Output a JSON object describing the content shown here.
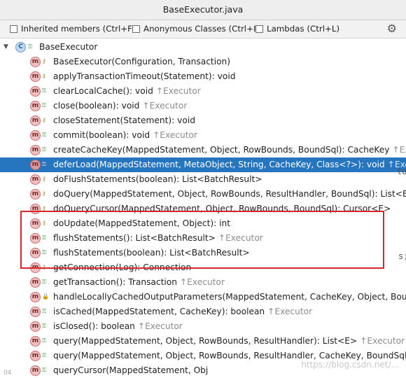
{
  "window": {
    "title": "BaseExecutor.java"
  },
  "options": {
    "inherited": "Inherited members (Ctrl+F3)",
    "anonymous": "Anonymous Classes (Ctrl+I)",
    "lambdas": "Lambdas (Ctrl+L)"
  },
  "class": {
    "name": "BaseExecutor",
    "icon": "C"
  },
  "methods": [
    {
      "sig": "BaseExecutor(Configuration, Transaction)",
      "inherit": "",
      "vis": "protected"
    },
    {
      "sig": "applyTransactionTimeout(Statement): void",
      "inherit": "",
      "vis": "protected"
    },
    {
      "sig": "clearLocalCache(): void",
      "inherit": "↑Executor",
      "vis": "public"
    },
    {
      "sig": "close(boolean): void",
      "inherit": "↑Executor",
      "vis": "public"
    },
    {
      "sig": "closeStatement(Statement): void",
      "inherit": "",
      "vis": "protected"
    },
    {
      "sig": "commit(boolean): void",
      "inherit": "↑Executor",
      "vis": "public"
    },
    {
      "sig": "createCacheKey(MappedStatement, Object, RowBounds, BoundSql): CacheKey",
      "inherit": "↑Exec",
      "vis": "public"
    },
    {
      "sig": "deferLoad(MappedStatement, MetaObject, String, CacheKey, Class<?>): void",
      "inherit": "↑Executo",
      "vis": "public",
      "selected": true
    },
    {
      "sig": "doFlushStatements(boolean): List<BatchResult>",
      "inherit": "",
      "vis": "protected"
    },
    {
      "sig": "doQuery(MappedStatement, Object, RowBounds, ResultHandler, BoundSql): List<E>",
      "inherit": "",
      "vis": "protected"
    },
    {
      "sig": "doQueryCursor(MappedStatement, Object, RowBounds, BoundSql): Cursor<E>",
      "inherit": "",
      "vis": "protected"
    },
    {
      "sig": "doUpdate(MappedStatement, Object): int",
      "inherit": "",
      "vis": "protected"
    },
    {
      "sig": "flushStatements(): List<BatchResult>",
      "inherit": "↑Executor",
      "vis": "public"
    },
    {
      "sig": "flushStatements(boolean): List<BatchResult>",
      "inherit": "",
      "vis": "public"
    },
    {
      "sig": "getConnection(Log): Connection",
      "inherit": "",
      "vis": "protected"
    },
    {
      "sig": "getTransaction(): Transaction",
      "inherit": "↑Executor",
      "vis": "public"
    },
    {
      "sig": "handleLocallyCachedOutputParameters(MappedStatement, CacheKey, Object, Bound",
      "inherit": "",
      "vis": "private"
    },
    {
      "sig": "isCached(MappedStatement, CacheKey): boolean",
      "inherit": "↑Executor",
      "vis": "public"
    },
    {
      "sig": "isClosed(): boolean",
      "inherit": "↑Executor",
      "vis": "public"
    },
    {
      "sig": "query(MappedStatement, Object, RowBounds, ResultHandler): List<E>",
      "inherit": "↑Executor",
      "vis": "public"
    },
    {
      "sig": "query(MappedStatement, Object, RowBounds, ResultHandler, CacheKey, BoundSql):",
      "inherit": "",
      "vis": "public"
    },
    {
      "sig": "queryCursor(MappedStatement, Obj",
      "inherit": "",
      "vis": "public"
    }
  ],
  "peek": {
    "a": "to",
    "b": "s;"
  },
  "watermark": "https://blog.csdn.net/...",
  "line_number": "04"
}
